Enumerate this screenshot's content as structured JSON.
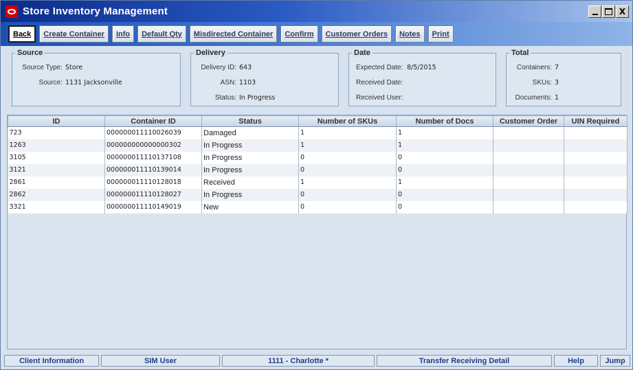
{
  "window": {
    "title": "Store Inventory Management",
    "buttons": [
      "_",
      "□",
      "X"
    ]
  },
  "toolbar": {
    "buttons": [
      {
        "label": "Back"
      },
      {
        "label": "Create Container"
      },
      {
        "label": "Info"
      },
      {
        "label": "Default Qty"
      },
      {
        "label": "Misdirected Container"
      },
      {
        "label": "Confirm"
      },
      {
        "label": "Customer Orders"
      },
      {
        "label": "Notes"
      },
      {
        "label": "Print"
      }
    ]
  },
  "source": {
    "title": "Source",
    "type_label": "Source Type:",
    "type_value": "Store",
    "source_label": "Source:",
    "source_value": "1131 Jacksonville"
  },
  "delivery": {
    "title": "Delivery",
    "id_label": "Delivery ID:",
    "id_value": "643",
    "asn_label": "ASN:",
    "asn_value": "1103",
    "status_label": "Status:",
    "status_value": "In Progress"
  },
  "date": {
    "title": "Date",
    "expected_label": "Expected Date:",
    "expected_value": "8/5/2015",
    "received_label": "Received Date:",
    "received_value": "",
    "user_label": "Received User:",
    "user_value": ""
  },
  "total": {
    "title": "Total",
    "containers_label": "Containers:",
    "containers_value": "7",
    "skus_label": "SKUs:",
    "skus_value": "3",
    "documents_label": "Documents:",
    "documents_value": "1"
  },
  "table": {
    "columns": [
      "ID",
      "Container ID",
      "Status",
      "Number of SKUs",
      "Number of Docs",
      "Customer Order",
      "UIN Required"
    ],
    "rows": [
      [
        "723",
        "000000011110026039",
        "Damaged",
        "1",
        "1",
        "",
        ""
      ],
      [
        "1263",
        "000000000000000302",
        "In Progress",
        "1",
        "1",
        "",
        ""
      ],
      [
        "3105",
        "000000011110137108",
        "In Progress",
        "0",
        "0",
        "",
        ""
      ],
      [
        "3121",
        "000000011110139014",
        "In Progress",
        "0",
        "0",
        "",
        ""
      ],
      [
        "2861",
        "000000011110128018",
        "Received",
        "1",
        "1",
        "",
        ""
      ],
      [
        "2862",
        "000000011110128027",
        "In Progress",
        "0",
        "0",
        "",
        ""
      ],
      [
        "3321",
        "000000011110149019",
        "New",
        "0",
        "0",
        "",
        ""
      ]
    ]
  },
  "statusbar": {
    "client_info": "Client Information",
    "user": "SIM User",
    "store": "1111 - Charlotte *",
    "screen": "Transfer Receiving Detail",
    "help": "Help",
    "jump": "Jump"
  },
  "colors": {
    "title_gradient_start": "#0b2b8a",
    "accent_text": "#1f3f8a",
    "background": "#d7e2ee"
  }
}
